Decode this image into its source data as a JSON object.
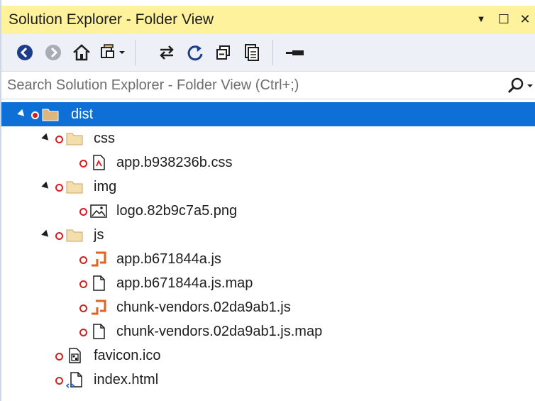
{
  "window": {
    "title": "Solution Explorer - Folder View",
    "dropdown_glyph": "▼",
    "restore_glyph": "☐",
    "close_glyph": "✕"
  },
  "toolbar": {
    "icons": [
      "back-icon",
      "forward-icon",
      "home-icon",
      "switch-views-icon",
      "sync-icon",
      "refresh-icon",
      "collapse-all-icon",
      "show-all-files-icon",
      "properties-icon"
    ]
  },
  "search": {
    "placeholder": "Search Solution Explorer - Folder View (Ctrl+;)"
  },
  "tree": {
    "root": "dist",
    "css_folder": "css",
    "css_file": "app.b938236b.css",
    "img_folder": "img",
    "img_file": "logo.82b9c7a5.png",
    "js_folder": "js",
    "js_file1": "app.b671844a.js",
    "js_file2": "app.b671844a.js.map",
    "js_file3": "chunk-vendors.02da9ab1.js",
    "js_file4": "chunk-vendors.02da9ab1.js.map",
    "favicon": "favicon.ico",
    "index": "index.html"
  },
  "colors": {
    "title_bar": "#fff29d",
    "selection": "#0e6fd6",
    "excluded_dot": "#d81e1e",
    "js_icon": "#e8611a",
    "folder": "#dcb67a"
  }
}
